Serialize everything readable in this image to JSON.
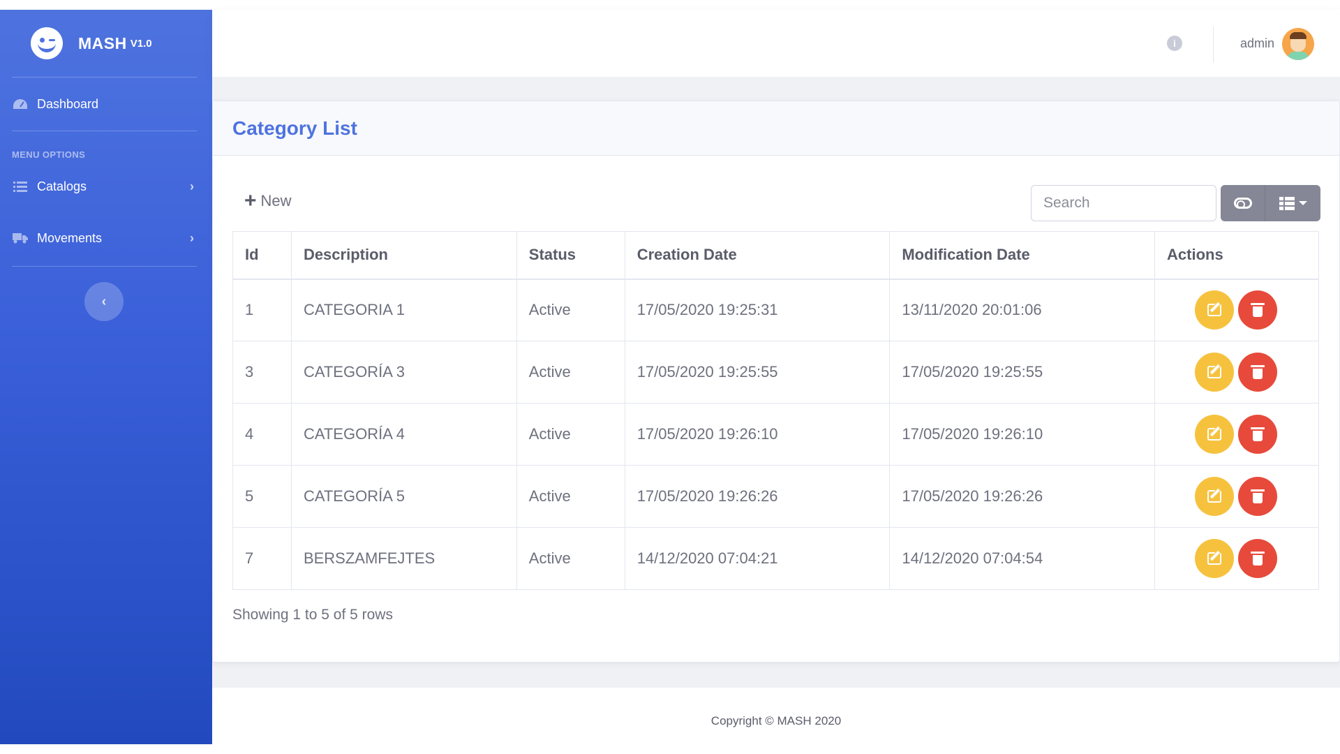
{
  "brand": {
    "name": "MASH",
    "version": "V1.0"
  },
  "sidebar": {
    "dashboard_label": "Dashboard",
    "menu_heading": "MENU OPTIONS",
    "items": [
      {
        "label": "Catalogs",
        "icon": "list-icon"
      },
      {
        "label": "Movements",
        "icon": "truck-icon"
      }
    ]
  },
  "topbar": {
    "user_name": "admin",
    "info_icon": "i"
  },
  "page": {
    "title": "Category List"
  },
  "toolbar": {
    "new_label": "New",
    "search_placeholder": "Search"
  },
  "table": {
    "headers": [
      "Id",
      "Description",
      "Status",
      "Creation Date",
      "Modification Date",
      "Actions"
    ],
    "rows": [
      {
        "id": "1",
        "description": "CATEGORIA 1",
        "status": "Active",
        "creation_date": "17/05/2020 19:25:31",
        "modification_date": "13/11/2020 20:01:06"
      },
      {
        "id": "3",
        "description": "CATEGORÍA 3",
        "status": "Active",
        "creation_date": "17/05/2020 19:25:55",
        "modification_date": "17/05/2020 19:25:55"
      },
      {
        "id": "4",
        "description": "CATEGORÍA 4",
        "status": "Active",
        "creation_date": "17/05/2020 19:26:10",
        "modification_date": "17/05/2020 19:26:10"
      },
      {
        "id": "5",
        "description": "CATEGORÍA 5",
        "status": "Active",
        "creation_date": "17/05/2020 19:26:26",
        "modification_date": "17/05/2020 19:26:26"
      },
      {
        "id": "7",
        "description": "BERSZAMFEJTES",
        "status": "Active",
        "creation_date": "14/12/2020 07:04:21",
        "modification_date": "14/12/2020 07:04:54"
      }
    ]
  },
  "pagination": {
    "info": "Showing 1 to 5 of 5 rows"
  },
  "footer": {
    "copyright": "Copyright © MASH 2020"
  },
  "colors": {
    "primary": "#4e73df",
    "warning": "#f6c23e",
    "danger": "#e74a3b",
    "secondary": "#858796"
  }
}
